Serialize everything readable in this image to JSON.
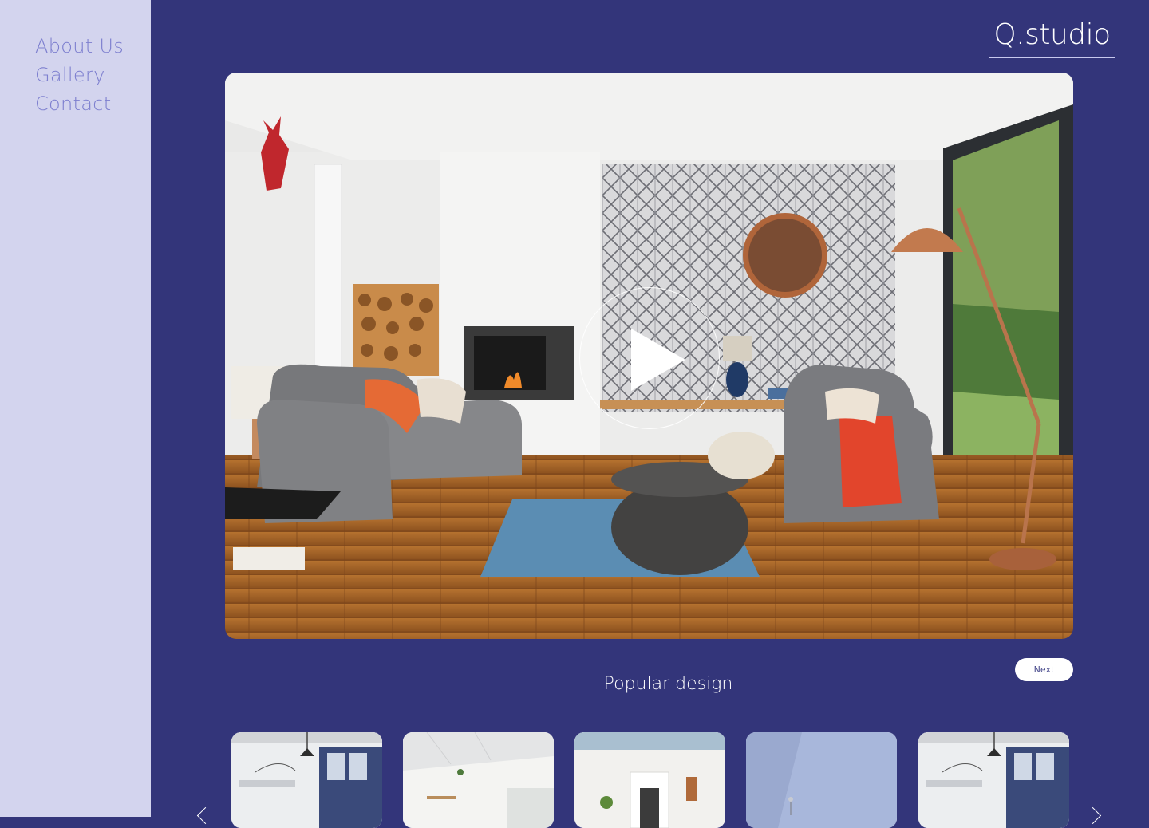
{
  "nav": {
    "items": [
      {
        "label": "About Us"
      },
      {
        "label": "Gallery"
      },
      {
        "label": "Contact"
      }
    ]
  },
  "brand": {
    "name": "Q.studio"
  },
  "hero": {
    "media": "video",
    "play_icon": "play-icon"
  },
  "popular": {
    "title": "Popular design",
    "next_label": "Next",
    "cards": [
      {
        "theme": "office"
      },
      {
        "theme": "white-kitchen"
      },
      {
        "theme": "living-room"
      },
      {
        "theme": "blue-wall"
      },
      {
        "theme": "office"
      }
    ]
  },
  "colors": {
    "background": "#33357a",
    "sidebar": "#d3d4ee",
    "nav_text": "#7d7fcf",
    "accent_white": "#ffffff"
  }
}
